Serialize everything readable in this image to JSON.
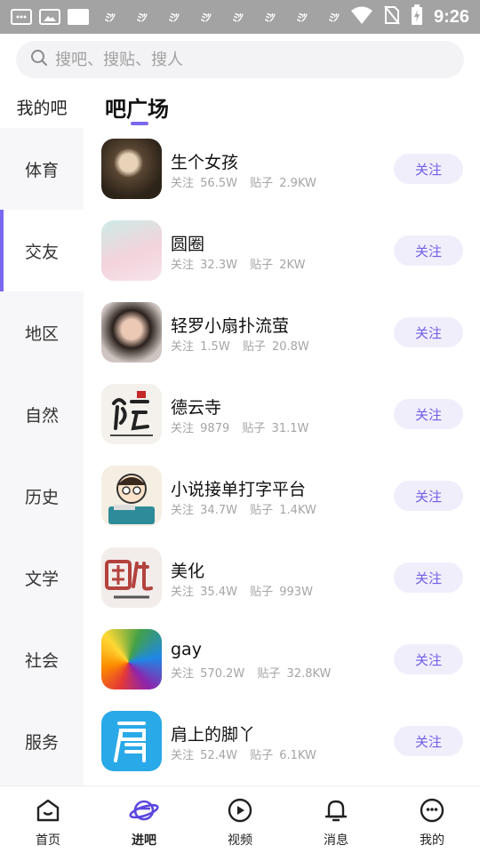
{
  "status_bar": {
    "time": "9:26",
    "app_badges": [
      "ﾐﾂ",
      "ﾐﾂ",
      "ﾐﾂ",
      "ﾐﾂ",
      "ﾐﾂ",
      "ﾐﾂ",
      "ﾐﾂ",
      "ﾐﾂ",
      "ﾐﾂ"
    ],
    "icons": [
      "message-icon",
      "image-icon",
      "app-icon",
      "wifi-icon",
      "no-sim-icon",
      "battery-charging-icon"
    ]
  },
  "search": {
    "placeholder": "搜吧、搜贴、搜人"
  },
  "sidebar": {
    "my_label": "我的吧",
    "items": [
      "体育",
      "交友",
      "地区",
      "自然",
      "历史",
      "文学",
      "社会",
      "服务"
    ],
    "active_index": 1
  },
  "main": {
    "title": "吧广场",
    "follow_label": "关注",
    "follow_prefix": "关注",
    "posts_prefix": "贴子",
    "forums": [
      {
        "name": "生个女孩",
        "followers": "56.5W",
        "posts": "2.9KW"
      },
      {
        "name": "圆圈",
        "followers": "32.3W",
        "posts": "2KW"
      },
      {
        "name": "轻罗小扇扑流萤",
        "followers": "1.5W",
        "posts": "20.8W"
      },
      {
        "name": "德云寺",
        "followers": "9879",
        "posts": "31.1W"
      },
      {
        "name": "小说接单打字平台",
        "followers": "34.7W",
        "posts": "1.4KW"
      },
      {
        "name": "美化",
        "followers": "35.4W",
        "posts": "993W"
      },
      {
        "name": "gay",
        "followers": "570.2W",
        "posts": "32.8KW"
      },
      {
        "name": "肩上的脚丫",
        "followers": "52.4W",
        "posts": "6.1KW"
      }
    ]
  },
  "bottom_nav": {
    "items": [
      {
        "label": "首页",
        "icon": "home-icon"
      },
      {
        "label": "进吧",
        "icon": "planet-icon"
      },
      {
        "label": "视频",
        "icon": "video-icon"
      },
      {
        "label": "消息",
        "icon": "bell-icon"
      },
      {
        "label": "我的",
        "icon": "profile-icon"
      }
    ],
    "active_index": 1
  },
  "colors": {
    "accent": "#7a68f0",
    "follow_bg": "#f1eefc",
    "follow_text": "#6f5ee6"
  }
}
